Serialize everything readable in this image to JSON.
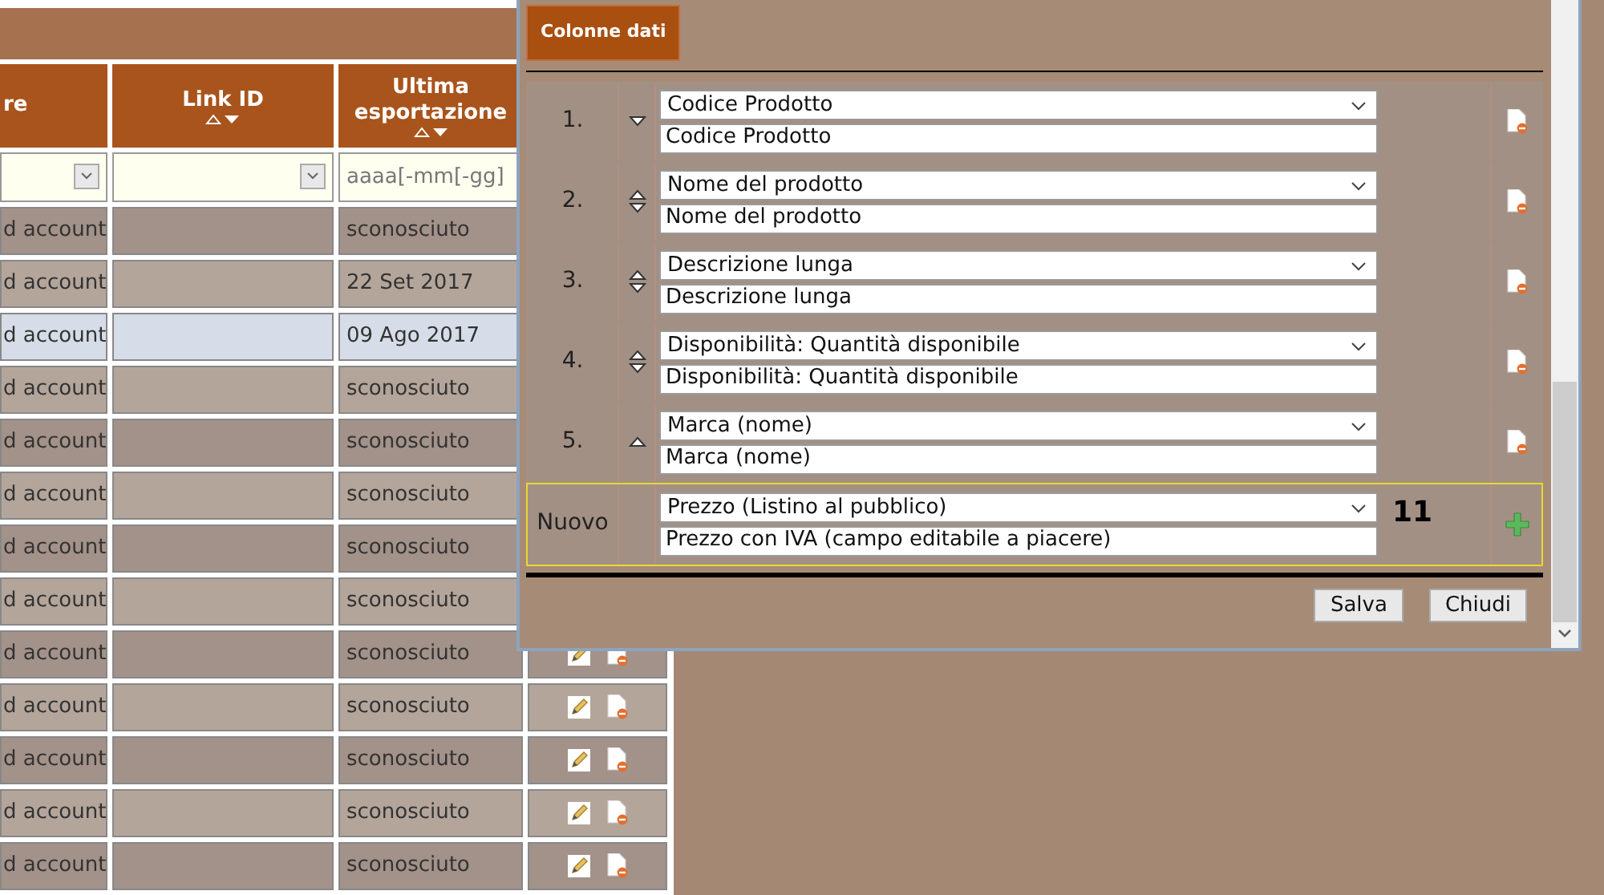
{
  "table": {
    "columns": [
      {
        "label": "re",
        "sortable": false
      },
      {
        "label": "Link ID",
        "sortable": true
      },
      {
        "label": "Ultima esportazione",
        "sortable": true
      }
    ],
    "filters": [
      {
        "kind": "select"
      },
      {
        "kind": "select"
      },
      {
        "kind": "input",
        "placeholder": "aaaa[-mm[-gg]"
      }
    ],
    "rows": [
      {
        "column_1": "d account",
        "link_id": "",
        "last_export": "sconosciuto",
        "selected": false
      },
      {
        "column_1": "d account",
        "link_id": "",
        "last_export": "22 Set 2017",
        "selected": false
      },
      {
        "column_1": "d account",
        "link_id": "",
        "last_export": "09 Ago 2017",
        "selected": true
      },
      {
        "column_1": "d account",
        "link_id": "",
        "last_export": "sconosciuto",
        "selected": false
      },
      {
        "column_1": "d account",
        "link_id": "",
        "last_export": "sconosciuto",
        "selected": false
      },
      {
        "column_1": "d account",
        "link_id": "",
        "last_export": "sconosciuto",
        "selected": false
      },
      {
        "column_1": "d account",
        "link_id": "",
        "last_export": "sconosciuto",
        "selected": false
      },
      {
        "column_1": "d account",
        "link_id": "",
        "last_export": "sconosciuto",
        "selected": false
      },
      {
        "column_1": "d account",
        "link_id": "",
        "last_export": "sconosciuto",
        "selected": false
      },
      {
        "column_1": "d account",
        "link_id": "",
        "last_export": "sconosciuto",
        "selected": false
      },
      {
        "column_1": "d account",
        "link_id": "",
        "last_export": "sconosciuto",
        "selected": false
      },
      {
        "column_1": "d account",
        "link_id": "",
        "last_export": "sconosciuto",
        "selected": false
      },
      {
        "column_1": "d account",
        "link_id": "",
        "last_export": "sconosciuto",
        "selected": false
      }
    ]
  },
  "dialog": {
    "tab": "Colonne dati",
    "rows": [
      {
        "kind": "column",
        "number": "1.",
        "move_up": false,
        "move_down": true,
        "field": "Codice Prodotto",
        "label": "Codice Prodotto"
      },
      {
        "kind": "column",
        "number": "2.",
        "move_up": true,
        "move_down": true,
        "field": "Nome del prodotto",
        "label": "Nome del prodotto"
      },
      {
        "kind": "column",
        "number": "3.",
        "move_up": true,
        "move_down": true,
        "field": "Descrizione lunga",
        "label": "Descrizione lunga"
      },
      {
        "kind": "column",
        "number": "4.",
        "move_up": true,
        "move_down": true,
        "field": "Disponibilità: Quantità disponibile",
        "label": "Disponibilità: Quantità disponibile"
      },
      {
        "kind": "column",
        "number": "5.",
        "move_up": true,
        "move_down": false,
        "field": "Marca (nome)",
        "label": "Marca (nome)"
      },
      {
        "kind": "new",
        "number": "Nuovo",
        "field": "Prezzo (Listino al pubblico)",
        "label": "Prezzo con IVA (campo editabile a piacere)",
        "count": "11"
      }
    ],
    "buttons": [
      "Salva",
      "Chiudi"
    ]
  }
}
